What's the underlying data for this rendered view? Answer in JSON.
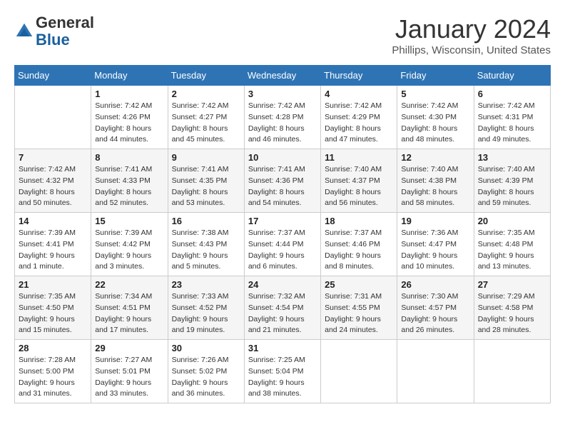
{
  "header": {
    "logo_line1": "General",
    "logo_line2": "Blue",
    "month": "January 2024",
    "location": "Phillips, Wisconsin, United States"
  },
  "weekdays": [
    "Sunday",
    "Monday",
    "Tuesday",
    "Wednesday",
    "Thursday",
    "Friday",
    "Saturday"
  ],
  "weeks": [
    [
      {
        "day": "",
        "info": ""
      },
      {
        "day": "1",
        "info": "Sunrise: 7:42 AM\nSunset: 4:26 PM\nDaylight: 8 hours\nand 44 minutes."
      },
      {
        "day": "2",
        "info": "Sunrise: 7:42 AM\nSunset: 4:27 PM\nDaylight: 8 hours\nand 45 minutes."
      },
      {
        "day": "3",
        "info": "Sunrise: 7:42 AM\nSunset: 4:28 PM\nDaylight: 8 hours\nand 46 minutes."
      },
      {
        "day": "4",
        "info": "Sunrise: 7:42 AM\nSunset: 4:29 PM\nDaylight: 8 hours\nand 47 minutes."
      },
      {
        "day": "5",
        "info": "Sunrise: 7:42 AM\nSunset: 4:30 PM\nDaylight: 8 hours\nand 48 minutes."
      },
      {
        "day": "6",
        "info": "Sunrise: 7:42 AM\nSunset: 4:31 PM\nDaylight: 8 hours\nand 49 minutes."
      }
    ],
    [
      {
        "day": "7",
        "info": "Sunrise: 7:42 AM\nSunset: 4:32 PM\nDaylight: 8 hours\nand 50 minutes."
      },
      {
        "day": "8",
        "info": "Sunrise: 7:41 AM\nSunset: 4:33 PM\nDaylight: 8 hours\nand 52 minutes."
      },
      {
        "day": "9",
        "info": "Sunrise: 7:41 AM\nSunset: 4:35 PM\nDaylight: 8 hours\nand 53 minutes."
      },
      {
        "day": "10",
        "info": "Sunrise: 7:41 AM\nSunset: 4:36 PM\nDaylight: 8 hours\nand 54 minutes."
      },
      {
        "day": "11",
        "info": "Sunrise: 7:40 AM\nSunset: 4:37 PM\nDaylight: 8 hours\nand 56 minutes."
      },
      {
        "day": "12",
        "info": "Sunrise: 7:40 AM\nSunset: 4:38 PM\nDaylight: 8 hours\nand 58 minutes."
      },
      {
        "day": "13",
        "info": "Sunrise: 7:40 AM\nSunset: 4:39 PM\nDaylight: 8 hours\nand 59 minutes."
      }
    ],
    [
      {
        "day": "14",
        "info": "Sunrise: 7:39 AM\nSunset: 4:41 PM\nDaylight: 9 hours\nand 1 minute."
      },
      {
        "day": "15",
        "info": "Sunrise: 7:39 AM\nSunset: 4:42 PM\nDaylight: 9 hours\nand 3 minutes."
      },
      {
        "day": "16",
        "info": "Sunrise: 7:38 AM\nSunset: 4:43 PM\nDaylight: 9 hours\nand 5 minutes."
      },
      {
        "day": "17",
        "info": "Sunrise: 7:37 AM\nSunset: 4:44 PM\nDaylight: 9 hours\nand 6 minutes."
      },
      {
        "day": "18",
        "info": "Sunrise: 7:37 AM\nSunset: 4:46 PM\nDaylight: 9 hours\nand 8 minutes."
      },
      {
        "day": "19",
        "info": "Sunrise: 7:36 AM\nSunset: 4:47 PM\nDaylight: 9 hours\nand 10 minutes."
      },
      {
        "day": "20",
        "info": "Sunrise: 7:35 AM\nSunset: 4:48 PM\nDaylight: 9 hours\nand 13 minutes."
      }
    ],
    [
      {
        "day": "21",
        "info": "Sunrise: 7:35 AM\nSunset: 4:50 PM\nDaylight: 9 hours\nand 15 minutes."
      },
      {
        "day": "22",
        "info": "Sunrise: 7:34 AM\nSunset: 4:51 PM\nDaylight: 9 hours\nand 17 minutes."
      },
      {
        "day": "23",
        "info": "Sunrise: 7:33 AM\nSunset: 4:52 PM\nDaylight: 9 hours\nand 19 minutes."
      },
      {
        "day": "24",
        "info": "Sunrise: 7:32 AM\nSunset: 4:54 PM\nDaylight: 9 hours\nand 21 minutes."
      },
      {
        "day": "25",
        "info": "Sunrise: 7:31 AM\nSunset: 4:55 PM\nDaylight: 9 hours\nand 24 minutes."
      },
      {
        "day": "26",
        "info": "Sunrise: 7:30 AM\nSunset: 4:57 PM\nDaylight: 9 hours\nand 26 minutes."
      },
      {
        "day": "27",
        "info": "Sunrise: 7:29 AM\nSunset: 4:58 PM\nDaylight: 9 hours\nand 28 minutes."
      }
    ],
    [
      {
        "day": "28",
        "info": "Sunrise: 7:28 AM\nSunset: 5:00 PM\nDaylight: 9 hours\nand 31 minutes."
      },
      {
        "day": "29",
        "info": "Sunrise: 7:27 AM\nSunset: 5:01 PM\nDaylight: 9 hours\nand 33 minutes."
      },
      {
        "day": "30",
        "info": "Sunrise: 7:26 AM\nSunset: 5:02 PM\nDaylight: 9 hours\nand 36 minutes."
      },
      {
        "day": "31",
        "info": "Sunrise: 7:25 AM\nSunset: 5:04 PM\nDaylight: 9 hours\nand 38 minutes."
      },
      {
        "day": "",
        "info": ""
      },
      {
        "day": "",
        "info": ""
      },
      {
        "day": "",
        "info": ""
      }
    ]
  ]
}
